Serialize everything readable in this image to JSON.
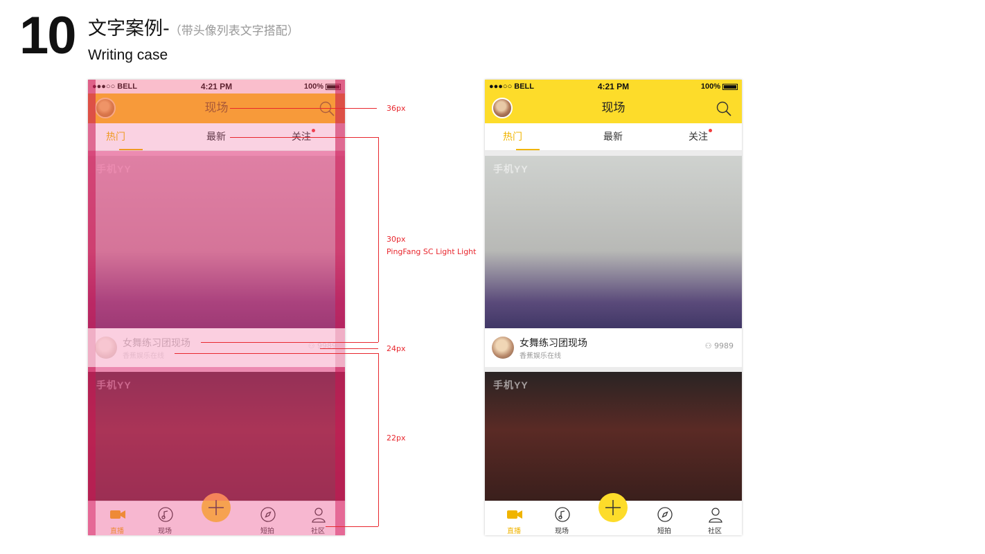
{
  "header": {
    "number": "10",
    "title": "文字案例-",
    "subtitle": "（带头像列表文字搭配）",
    "en_title": "Writing case"
  },
  "status_bar": {
    "carrier": "●●●○○ BELL",
    "time": "4:21 PM",
    "battery": "100%"
  },
  "nav": {
    "title": "现场"
  },
  "tabs": [
    {
      "label": "热门",
      "active": true
    },
    {
      "label": "最新"
    },
    {
      "label": "关注",
      "badge": true
    }
  ],
  "feed": {
    "watermark": "手机YY",
    "item1": {
      "title": "女舞练习团现场",
      "subtitle": "香蕉娱乐在线",
      "viewers": "9989"
    }
  },
  "tabbar": [
    {
      "label": "直播",
      "icon": "video-camera-icon",
      "active": true
    },
    {
      "label": "现场",
      "icon": "music-note-icon"
    },
    {
      "label": "",
      "icon": "plus-icon"
    },
    {
      "label": "短拍",
      "icon": "compass-icon"
    },
    {
      "label": "社区",
      "icon": "user-icon"
    }
  ],
  "annotations": {
    "a1": "36px",
    "a2": "30px",
    "a2_font": "PingFang SC Light Light",
    "a3": "24px",
    "a4": "22px"
  },
  "colors": {
    "accent": "#fddc2a",
    "active_text": "#f0b400",
    "annotation": "#e8262d",
    "overlay_pink": "#ec4a8a"
  }
}
